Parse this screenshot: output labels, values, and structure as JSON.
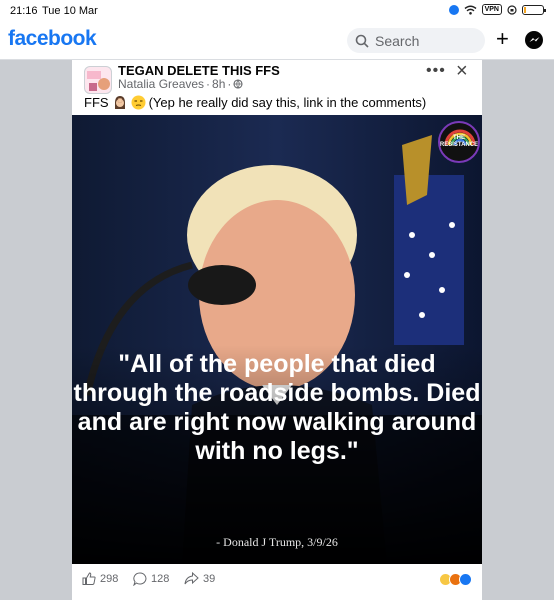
{
  "status_bar": {
    "time": "21:16",
    "date": "Tue 10 Mar",
    "vpn": "VPN"
  },
  "header": {
    "logo": "facebook",
    "search_placeholder": "Search"
  },
  "post": {
    "group_name": "TEGAN DELETE THIS FFS",
    "author": "Natalia Greaves",
    "time": "8h",
    "caption_prefix": "FFS",
    "caption_text": "(Yep he really did say this, link in the comments)",
    "image": {
      "badge_line1": "THE",
      "badge_line2": "RESISTANCE",
      "quote": "\"All of the people that died through the roadside bombs. Died and are right now walking around with no legs.\"",
      "attribution": "- Donald J Trump, 3/9/26"
    },
    "likes": "298",
    "comments": "128",
    "shares": "39"
  },
  "colors": {
    "brand": "#1877f2",
    "card_bg": "#ffffff",
    "feed_bg": "#c9ccd1"
  },
  "icons": [
    "location-icon",
    "wifi-icon",
    "vpn-icon",
    "battery-icon",
    "search-icon",
    "plus-icon",
    "messenger-icon",
    "globe-icon",
    "more-icon",
    "close-icon",
    "like-icon",
    "comment-icon",
    "share-icon"
  ]
}
